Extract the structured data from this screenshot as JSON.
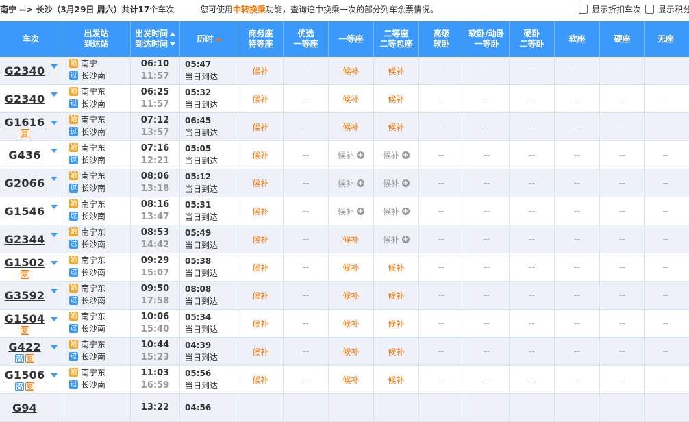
{
  "top": {
    "route_prefix": "南宁 --> 长沙（",
    "route_date": "3月29日  周六",
    "route_suffix": "）共计",
    "count": "17",
    "count_suffix": "个车次",
    "tip_prefix": "您可使用",
    "tip_highlight": "中转换乘",
    "tip_suffix": "功能，查询途中换乘一次的部分列车余票情况。",
    "opt_discount": "显示折扣车次",
    "opt_points": "显示积分"
  },
  "headers": {
    "train": "车次",
    "station_1": "出发站",
    "station_2": "到达站",
    "time_1": "出发时间",
    "time_2": "到达时间",
    "duration": "历时",
    "business_1": "商务座",
    "business_2": "特等座",
    "premium_1": "优选",
    "premium_2": "一等座",
    "first": "一等座",
    "second_1": "二等座",
    "second_2": "二等包座",
    "high_soft_1": "高级",
    "high_soft_2": "软卧",
    "soft_sleeper_1": "软卧/动卧",
    "soft_sleeper_2": "一等卧",
    "hard_sleeper_1": "硬卧",
    "hard_sleeper_2": "二等卧",
    "soft_seat": "软座",
    "hard_seat": "硬座",
    "no_seat": "无座"
  },
  "labels": {
    "start": "始",
    "pass": "过",
    "same_day": "当日到达",
    "dash": "--",
    "houbu": "候补",
    "plus": "+",
    "fu": "复",
    "zhi": "智"
  },
  "trains": [
    {
      "code": "G2340",
      "tags": [],
      "from": "南宁",
      "from_type": "始",
      "to": "长沙南",
      "dep": "06:10",
      "arr": "11:57",
      "dur": "05:47",
      "first_style": "orange",
      "second_style": "orange"
    },
    {
      "code": "G2340",
      "tags": [],
      "from": "南宁东",
      "from_type": "始",
      "to": "长沙南",
      "dep": "06:25",
      "arr": "11:57",
      "dur": "05:32",
      "first_style": "orange",
      "second_style": "orange"
    },
    {
      "code": "G1616",
      "tags": [
        "复"
      ],
      "from": "南宁东",
      "from_type": "始",
      "to": "长沙南",
      "dep": "07:12",
      "arr": "13:57",
      "dur": "06:45",
      "first_style": "orange",
      "second_style": "orange"
    },
    {
      "code": "G436",
      "tags": [],
      "from": "南宁东",
      "from_type": "始",
      "to": "长沙南",
      "dep": "07:16",
      "arr": "12:21",
      "dur": "05:05",
      "first_style": "gray",
      "second_style": "gray"
    },
    {
      "code": "G2066",
      "tags": [],
      "from": "南宁东",
      "from_type": "始",
      "to": "长沙南",
      "dep": "08:06",
      "arr": "13:18",
      "dur": "05:12",
      "first_style": "gray",
      "second_style": "gray"
    },
    {
      "code": "G1546",
      "tags": [],
      "from": "南宁东",
      "from_type": "始",
      "to": "长沙南",
      "dep": "08:16",
      "arr": "13:47",
      "dur": "05:31",
      "first_style": "gray",
      "second_style": "gray"
    },
    {
      "code": "G2344",
      "tags": [],
      "from": "南宁东",
      "from_type": "始",
      "to": "长沙南",
      "dep": "08:53",
      "arr": "14:42",
      "dur": "05:49",
      "first_style": "orange",
      "second_style": "gray"
    },
    {
      "code": "G1502",
      "tags": [
        "复"
      ],
      "from": "南宁东",
      "from_type": "始",
      "to": "长沙南",
      "dep": "09:29",
      "arr": "15:07",
      "dur": "05:38",
      "first_style": "orange",
      "second_style": "orange"
    },
    {
      "code": "G3592",
      "tags": [],
      "from": "南宁东",
      "from_type": "始",
      "to": "长沙南",
      "dep": "09:50",
      "arr": "17:58",
      "dur": "08:08",
      "first_style": "orange",
      "second_style": "orange"
    },
    {
      "code": "G1504",
      "tags": [
        "复"
      ],
      "from": "南宁东",
      "from_type": "始",
      "to": "长沙南",
      "dep": "10:06",
      "arr": "15:40",
      "dur": "05:34",
      "first_style": "orange",
      "second_style": "orange"
    },
    {
      "code": "G422",
      "tags": [
        "智",
        "复"
      ],
      "from": "南宁东",
      "from_type": "始",
      "to": "长沙南",
      "dep": "10:44",
      "arr": "15:23",
      "dur": "04:39",
      "first_style": "orange",
      "second_style": "orange"
    },
    {
      "code": "G1506",
      "tags": [
        "智",
        "复"
      ],
      "from": "南宁东",
      "from_type": "始",
      "to": "长沙南",
      "dep": "11:03",
      "arr": "16:59",
      "dur": "05:56",
      "first_style": "orange",
      "second_style": "orange"
    },
    {
      "code": "G94",
      "tags": [],
      "from": "",
      "from_type": "",
      "to": "",
      "dep": "13:22",
      "arr": "",
      "dur": "04:56",
      "first_style": "",
      "second_style": ""
    }
  ]
}
